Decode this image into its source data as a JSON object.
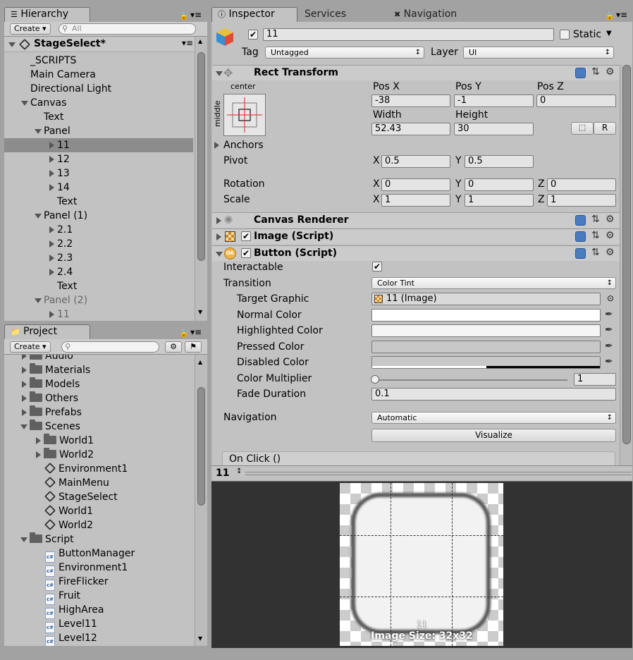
{
  "hierarchy": {
    "tab": "Hierarchy",
    "create": "Create",
    "search_placeholder": "All",
    "scene": "StageSelect*",
    "items": [
      {
        "label": "_SCRIPTS",
        "depth": 1,
        "arrow": "none"
      },
      {
        "label": "Main Camera",
        "depth": 1,
        "arrow": "none"
      },
      {
        "label": "Directional Light",
        "depth": 1,
        "arrow": "none"
      },
      {
        "label": "Canvas",
        "depth": 1,
        "arrow": "down"
      },
      {
        "label": "Text",
        "depth": 2,
        "arrow": "none"
      },
      {
        "label": "Panel",
        "depth": 2,
        "arrow": "down"
      },
      {
        "label": "11",
        "depth": 3,
        "arrow": "right",
        "selected": true
      },
      {
        "label": "12",
        "depth": 3,
        "arrow": "right"
      },
      {
        "label": "13",
        "depth": 3,
        "arrow": "right"
      },
      {
        "label": "14",
        "depth": 3,
        "arrow": "right"
      },
      {
        "label": "Text",
        "depth": 3,
        "arrow": "none"
      },
      {
        "label": "Panel (1)",
        "depth": 2,
        "arrow": "down"
      },
      {
        "label": "2.1",
        "depth": 3,
        "arrow": "right"
      },
      {
        "label": "2.2",
        "depth": 3,
        "arrow": "right"
      },
      {
        "label": "2.3",
        "depth": 3,
        "arrow": "right"
      },
      {
        "label": "2.4",
        "depth": 3,
        "arrow": "right"
      },
      {
        "label": "Text",
        "depth": 3,
        "arrow": "none"
      },
      {
        "label": "Panel (2)",
        "depth": 2,
        "arrow": "down",
        "dim": true
      },
      {
        "label": "11",
        "depth": 3,
        "arrow": "right",
        "dim": true
      }
    ]
  },
  "project": {
    "tab": "Project",
    "create": "Create",
    "items": [
      {
        "label": "Audio",
        "depth": 0,
        "type": "folder",
        "arrow": "right"
      },
      {
        "label": "Materials",
        "depth": 0,
        "type": "folder",
        "arrow": "right"
      },
      {
        "label": "Models",
        "depth": 0,
        "type": "folder",
        "arrow": "right"
      },
      {
        "label": "Others",
        "depth": 0,
        "type": "folder",
        "arrow": "right"
      },
      {
        "label": "Prefabs",
        "depth": 0,
        "type": "folder",
        "arrow": "right"
      },
      {
        "label": "Scenes",
        "depth": 0,
        "type": "folder",
        "arrow": "down"
      },
      {
        "label": "World1",
        "depth": 1,
        "type": "folder",
        "arrow": "right"
      },
      {
        "label": "World2",
        "depth": 1,
        "type": "folder",
        "arrow": "right"
      },
      {
        "label": "Environment1",
        "depth": 1,
        "type": "unity",
        "arrow": "none"
      },
      {
        "label": "MainMenu",
        "depth": 1,
        "type": "unity",
        "arrow": "none"
      },
      {
        "label": "StageSelect",
        "depth": 1,
        "type": "unity",
        "arrow": "none"
      },
      {
        "label": "World1",
        "depth": 1,
        "type": "unity",
        "arrow": "none"
      },
      {
        "label": "World2",
        "depth": 1,
        "type": "unity",
        "arrow": "none"
      },
      {
        "label": "Script",
        "depth": 0,
        "type": "folder",
        "arrow": "down"
      },
      {
        "label": "ButtonManager",
        "depth": 1,
        "type": "cs",
        "arrow": "none"
      },
      {
        "label": "Environment1",
        "depth": 1,
        "type": "cs",
        "arrow": "none"
      },
      {
        "label": "FireFlicker",
        "depth": 1,
        "type": "cs",
        "arrow": "none"
      },
      {
        "label": "Fruit",
        "depth": 1,
        "type": "cs",
        "arrow": "none"
      },
      {
        "label": "HighArea",
        "depth": 1,
        "type": "cs",
        "arrow": "none"
      },
      {
        "label": "Level11",
        "depth": 1,
        "type": "cs",
        "arrow": "none"
      },
      {
        "label": "Level12",
        "depth": 1,
        "type": "cs",
        "arrow": "none"
      }
    ]
  },
  "inspector": {
    "tabs": [
      "Inspector",
      "Services",
      "Navigation"
    ],
    "object_name": "11",
    "static_label": "Static",
    "tag_label": "Tag",
    "tag_value": "Untagged",
    "layer_label": "Layer",
    "layer_value": "UI",
    "rect_transform": {
      "title": "Rect Transform",
      "anchor_h": "center",
      "anchor_v": "middle",
      "posx_label": "Pos X",
      "posx": "-38",
      "posy_label": "Pos Y",
      "posy": "-1",
      "posz_label": "Pos Z",
      "posz": "0",
      "width_label": "Width",
      "width": "52.43",
      "height_label": "Height",
      "height": "30",
      "r_button": "R",
      "anchors_label": "Anchors",
      "pivot_label": "Pivot",
      "pivot_x": "0.5",
      "pivot_y": "0.5",
      "rotation_label": "Rotation",
      "rot_x": "0",
      "rot_y": "0",
      "rot_z": "0",
      "scale_label": "Scale",
      "scale_x": "1",
      "scale_y": "1",
      "scale_z": "1",
      "x": "X",
      "y": "Y",
      "z": "Z"
    },
    "canvas_renderer": "Canvas Renderer",
    "image_script": "Image (Script)",
    "button_script": {
      "title": "Button (Script)",
      "interactable_label": "Interactable",
      "transition_label": "Transition",
      "transition_value": "Color Tint",
      "target_graphic_label": "Target Graphic",
      "target_graphic_value": "11 (Image)",
      "normal_color_label": "Normal Color",
      "highlighted_color_label": "Highlighted Color",
      "pressed_color_label": "Pressed Color",
      "disabled_color_label": "Disabled Color",
      "color_multiplier_label": "Color Multiplier",
      "color_multiplier_value": "1",
      "fade_duration_label": "Fade Duration",
      "fade_duration_value": "0.1",
      "navigation_label": "Navigation",
      "navigation_value": "Automatic",
      "visualize": "Visualize",
      "on_click": "On Click ()"
    },
    "colors": {
      "normal": "#ffffff",
      "highlighted": "#f5f5f5",
      "pressed": "#c8c8c8",
      "disabled": "#c8c8c8"
    }
  },
  "preview": {
    "title": "11",
    "label": "11",
    "image_size": "Image Size: 32x32"
  }
}
